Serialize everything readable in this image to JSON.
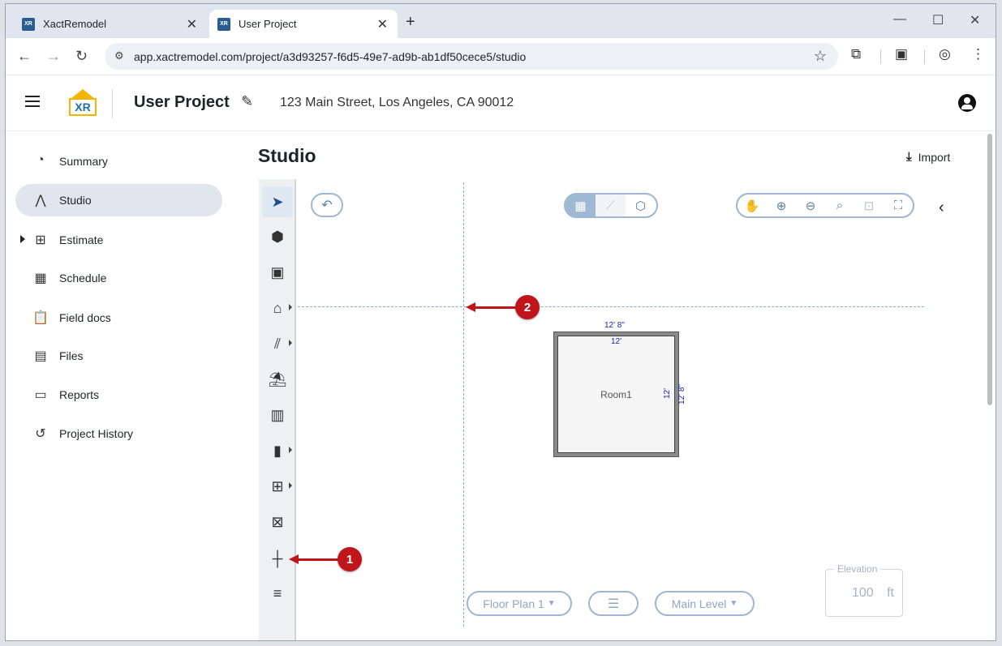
{
  "browser": {
    "tabs": [
      {
        "title": "XactRemodel",
        "favicon": "XR"
      },
      {
        "title": "User Project",
        "favicon": "XR"
      }
    ],
    "url": "app.xactremodel.com/project/a3d93257-f6d5-49e7-ad9b-ab1df50cece5/studio"
  },
  "header": {
    "logo_text": "XR",
    "project_title": "User Project",
    "address": "123 Main Street, Los Angeles, CA 90012"
  },
  "sidebar": {
    "items": [
      {
        "label": "Summary",
        "icon": "speedometer-icon"
      },
      {
        "label": "Studio",
        "icon": "compass-icon"
      },
      {
        "label": "Estimate",
        "icon": "calculator-icon"
      },
      {
        "label": "Schedule",
        "icon": "calendar-icon"
      },
      {
        "label": "Field docs",
        "icon": "clipboard-plus-icon"
      },
      {
        "label": "Files",
        "icon": "images-icon"
      },
      {
        "label": "Reports",
        "icon": "document-icon"
      },
      {
        "label": "Project History",
        "icon": "history-icon"
      }
    ]
  },
  "main": {
    "title": "Studio",
    "import_label": "Import"
  },
  "canvas": {
    "room_name": "Room1",
    "dim_outer_top": "12' 8\"",
    "dim_inner_top": "12'",
    "dim_inner_right": "12'",
    "dim_outer_right": "12' 8\""
  },
  "bottom_controls": {
    "floor_plan_label": "Floor Plan 1",
    "level_label": "Main Level",
    "elevation_label": "Elevation",
    "elevation_value": "100",
    "elevation_unit": "ft"
  },
  "annotations": [
    "1",
    "2"
  ],
  "colors": {
    "accent": "#9fb8d4",
    "annotation": "#c0151b",
    "dimension": "#1b22b8",
    "logo": "#f4b400"
  }
}
